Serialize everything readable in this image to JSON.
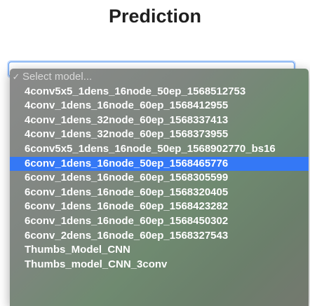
{
  "header": {
    "title": "Prediction"
  },
  "model_select": {
    "placeholder": "Select model...",
    "selected_check": "✓",
    "highlighted_index": 5,
    "options": [
      "4conv5x5_1dens_16node_50ep_1568512753",
      "4conv_1dens_16node_60ep_1568412955",
      "4conv_1dens_32node_60ep_1568337413",
      "4conv_1dens_32node_60ep_1568373955",
      "6conv5x5_1dens_16node_50ep_1568902770_bs16",
      "6conv_1dens_16node_50ep_1568465776",
      "6conv_1dens_16node_60ep_1568305599",
      "6conv_1dens_16node_60ep_1568320405",
      "6conv_1dens_16node_60ep_1568423282",
      "6conv_1dens_16node_60ep_1568450302",
      "6conv_2dens_16node_60ep_1568327543",
      "Thumbs_Model_CNN",
      "Thumbs_model_CNN_3conv"
    ]
  }
}
